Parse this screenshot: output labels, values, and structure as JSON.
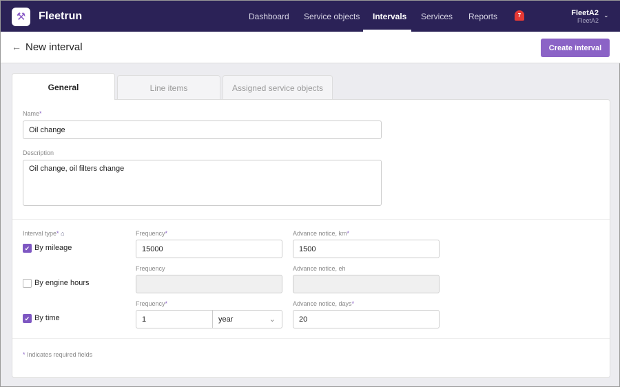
{
  "app": {
    "name": "Fleetrun",
    "logo_icon": "mechanic-logo-icon"
  },
  "nav": {
    "items": [
      "Dashboard",
      "Service objects",
      "Intervals",
      "Services",
      "Reports"
    ],
    "active": "Intervals",
    "notifications": "7",
    "user": "FleetA2",
    "user_sub": "FleetA2"
  },
  "header": {
    "title": "New interval",
    "create_label": "Create interval"
  },
  "tabs": [
    "General",
    "Line items",
    "Assigned service objects"
  ],
  "form": {
    "name_label": "Name",
    "name_value": "Oil change",
    "description_label": "Description",
    "description_value": "Oil change, oil filters change",
    "interval_type_label": "Interval type",
    "rows": [
      {
        "label": "By mileage",
        "checked": true,
        "freq_label": "Frequency",
        "freq_required": true,
        "freq_value": "15000",
        "adv_label": "Advance notice, km",
        "adv_required": true,
        "adv_value": "1500"
      },
      {
        "label": "By engine hours",
        "checked": false,
        "freq_label": "Frequency",
        "freq_required": false,
        "freq_value": "",
        "adv_label": "Advance notice, eh",
        "adv_required": false,
        "adv_value": ""
      },
      {
        "label": "By time",
        "checked": true,
        "freq_label": "Frequency",
        "freq_required": true,
        "freq_value": "1",
        "unit": "year",
        "adv_label": "Advance notice, days",
        "adv_required": true,
        "adv_value": "20"
      }
    ],
    "required_note": "Indicates required fields",
    "asterisk": "*"
  },
  "colors": {
    "nav": "#2b2257",
    "accent": "#8b63c6"
  }
}
